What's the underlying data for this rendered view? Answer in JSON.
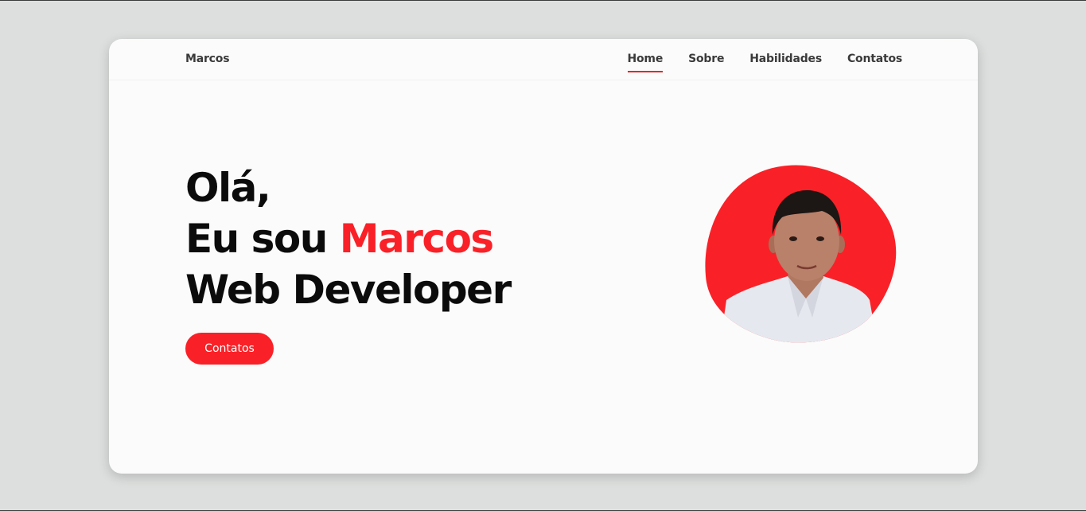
{
  "header": {
    "logo": "Marcos",
    "nav": [
      {
        "label": "Home",
        "active": true
      },
      {
        "label": "Sobre",
        "active": false
      },
      {
        "label": "Habilidades",
        "active": false
      },
      {
        "label": "Contatos",
        "active": false
      }
    ]
  },
  "hero": {
    "greeting": "Olá,",
    "intro_prefix": "Eu sou ",
    "name": "Marcos",
    "role": "Web Developer",
    "cta_label": "Contatos"
  },
  "colors": {
    "accent": "#f92127",
    "background": "#dddfde",
    "card": "#fbfbfb"
  },
  "icons": {
    "profile": "portrait-photo"
  }
}
